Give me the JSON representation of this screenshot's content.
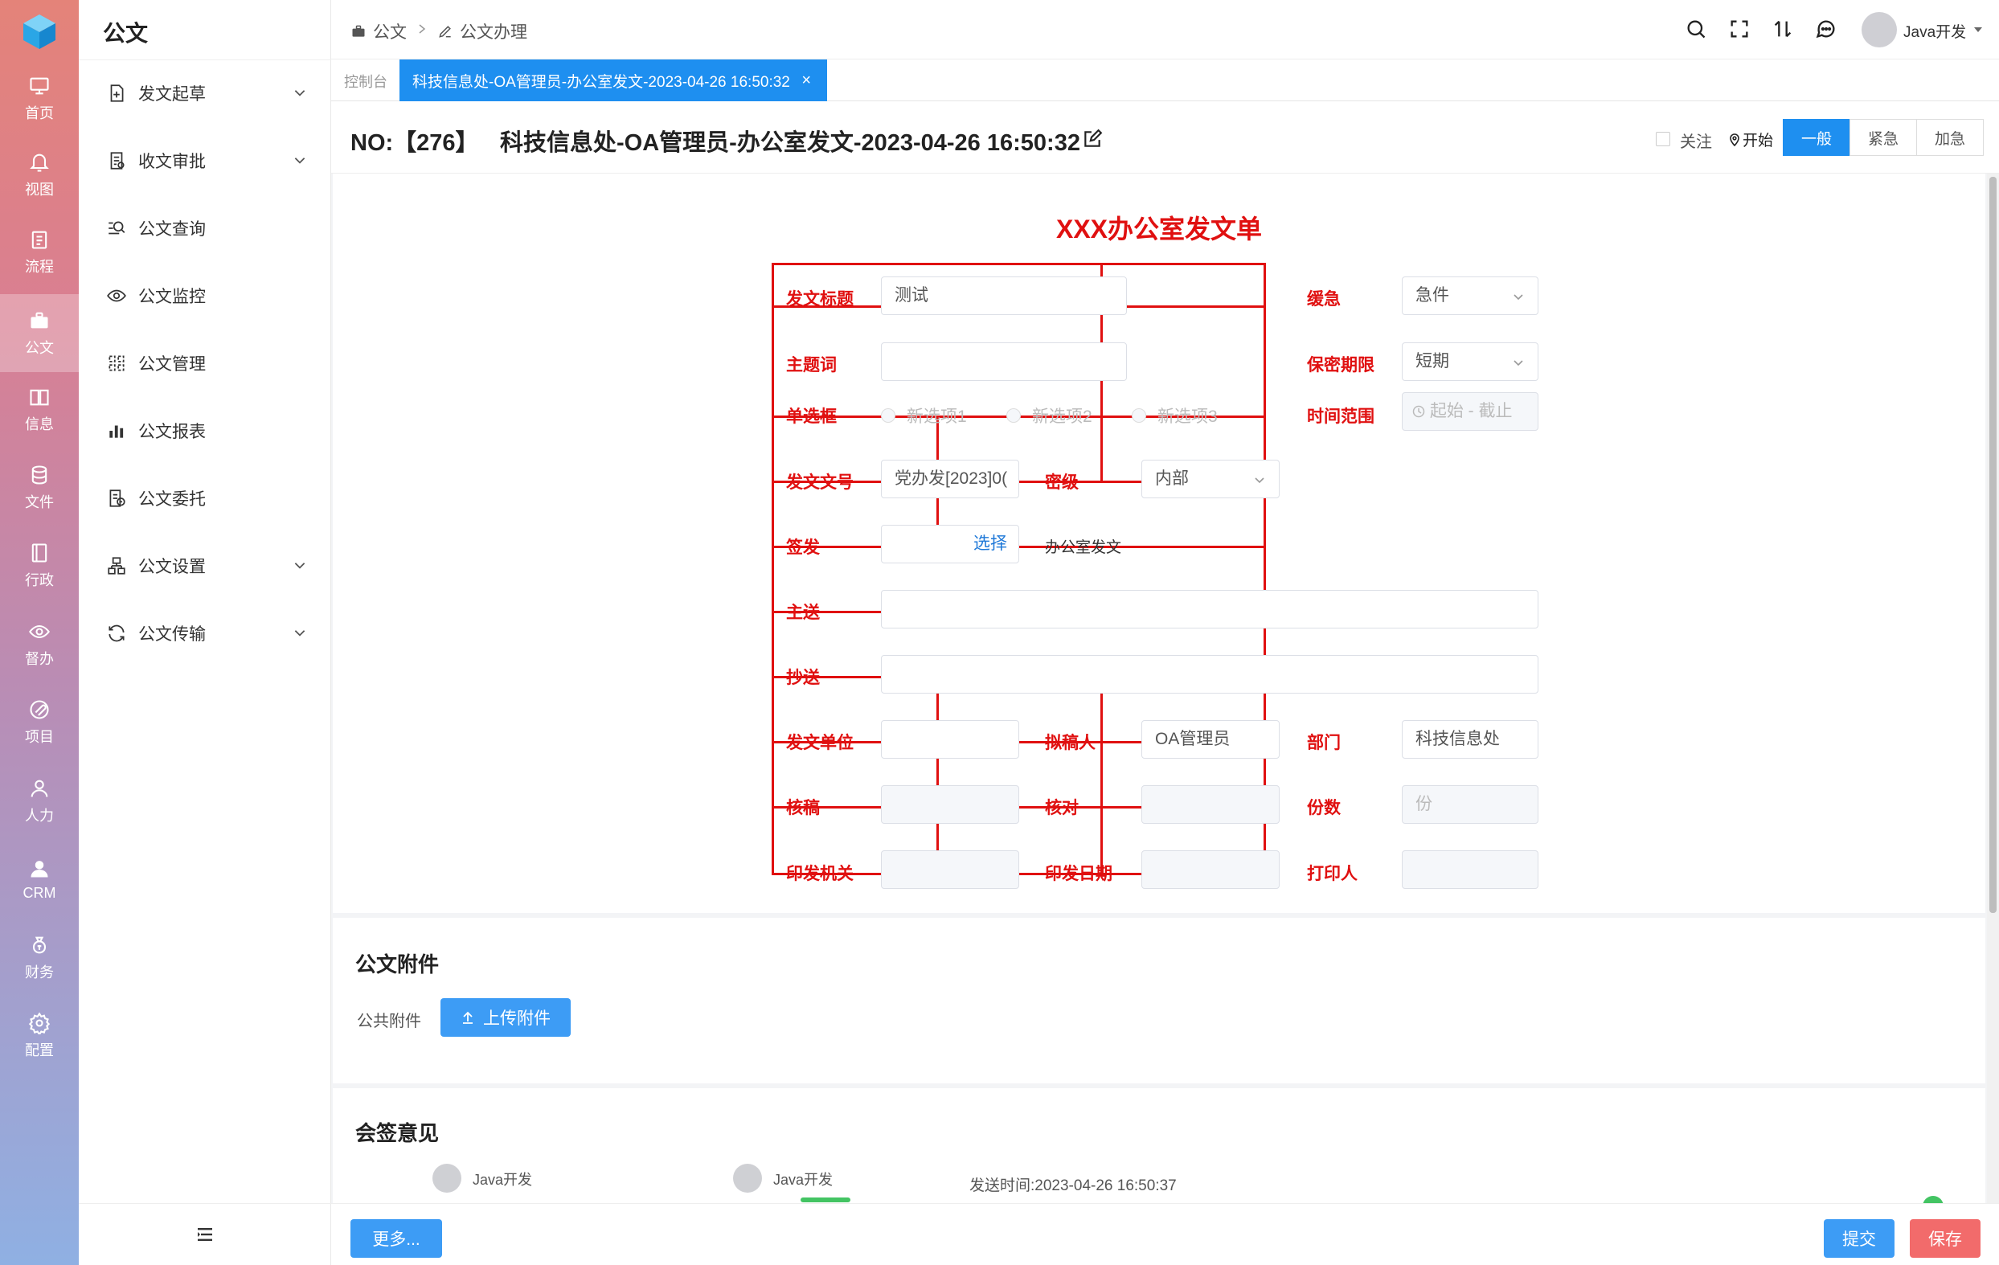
{
  "rail": [
    {
      "label": "首页",
      "icon": "monitor-icon"
    },
    {
      "label": "视图",
      "icon": "bell-icon"
    },
    {
      "label": "流程",
      "icon": "clipboard-icon"
    },
    {
      "label": "公文",
      "icon": "briefcase-icon",
      "active": true
    },
    {
      "label": "信息",
      "icon": "book-icon"
    },
    {
      "label": "文件",
      "icon": "database-icon"
    },
    {
      "label": "行政",
      "icon": "folder-icon"
    },
    {
      "label": "督办",
      "icon": "eye-icon"
    },
    {
      "label": "项目",
      "icon": "paperclip-icon"
    },
    {
      "label": "人力",
      "icon": "user-icon"
    },
    {
      "label": "CRM",
      "icon": "customer-icon"
    },
    {
      "label": "财务",
      "icon": "moneybag-icon"
    },
    {
      "label": "配置",
      "icon": "gear-icon"
    }
  ],
  "sidebar": {
    "title": "公文",
    "items": [
      {
        "label": "发文起草",
        "icon": "file-plus-icon",
        "expandable": true
      },
      {
        "label": "收文审批",
        "icon": "doc-check-icon",
        "expandable": true
      },
      {
        "label": "公文查询",
        "icon": "search-list-icon"
      },
      {
        "label": "公文监控",
        "icon": "eye-icon"
      },
      {
        "label": "公文管理",
        "icon": "grid-icon"
      },
      {
        "label": "公文报表",
        "icon": "bar-chart-icon"
      },
      {
        "label": "公文委托",
        "icon": "delegate-icon"
      },
      {
        "label": "公文设置",
        "icon": "settings-tree-icon",
        "expandable": true
      },
      {
        "label": "公文传输",
        "icon": "refresh-icon",
        "expandable": true
      }
    ]
  },
  "breadcrumb": [
    "公文",
    "公文办理"
  ],
  "user": {
    "name": "Java开发"
  },
  "tabs": {
    "console": "控制台",
    "active": "科技信息处-OA管理员-办公室发文-2023-04-26 16:50:32",
    "close": "×"
  },
  "header": {
    "no": "NO:【276】",
    "title": "科技信息处-OA管理员-办公室发文-2023-04-26 16:50:32",
    "follow": "关注",
    "start": "开始",
    "urgency": [
      "一般",
      "紧急",
      "加急"
    ],
    "urgency_selected": "一般"
  },
  "form": {
    "title": "XXX办公室发文单",
    "labels": {
      "title": "发文标题",
      "urgent": "缓急",
      "keyword": "主题词",
      "secret_period": "保密期限",
      "radio": "单选框",
      "time_range": "时间范围",
      "doc_no": "发文文号",
      "secret_level": "密级",
      "issue": "签发",
      "main_send": "主送",
      "cc": "抄送",
      "unit": "发文单位",
      "drafter": "拟稿人",
      "dept": "部门",
      "review": "核稿",
      "check": "核对",
      "copies": "份数",
      "print_org": "印发机关",
      "print_date": "印发日期",
      "printer": "打印人"
    },
    "values": {
      "title": "测试",
      "urgent": "急件",
      "keyword": "",
      "secret_period": "短期",
      "radio_options": [
        "新选项1",
        "新选项2",
        "新选项3"
      ],
      "time_range": "起始 - 截止",
      "doc_no": "党办发[2023]0(",
      "secret_level": "内部",
      "issue_select": "选择",
      "issue_text": "办公室发文",
      "main_send": "",
      "cc": "",
      "unit": "",
      "drafter": "OA管理员",
      "dept": "科技信息处",
      "copies_placeholder": "份"
    }
  },
  "attachments": {
    "title": "公文附件",
    "public_label": "公共附件",
    "upload": "上传附件"
  },
  "signoff": {
    "title": "会签意见",
    "users": [
      "Java开发",
      "Java开发"
    ],
    "send_time": "发送时间:2023-04-26 16:50:37"
  },
  "footer": {
    "more": "更多...",
    "submit": "提交",
    "save": "保存"
  },
  "colors": {
    "accent": "#1e8ff0",
    "form_red": "#e01010",
    "save": "#f26b6b",
    "submit": "#3d9cf5"
  }
}
